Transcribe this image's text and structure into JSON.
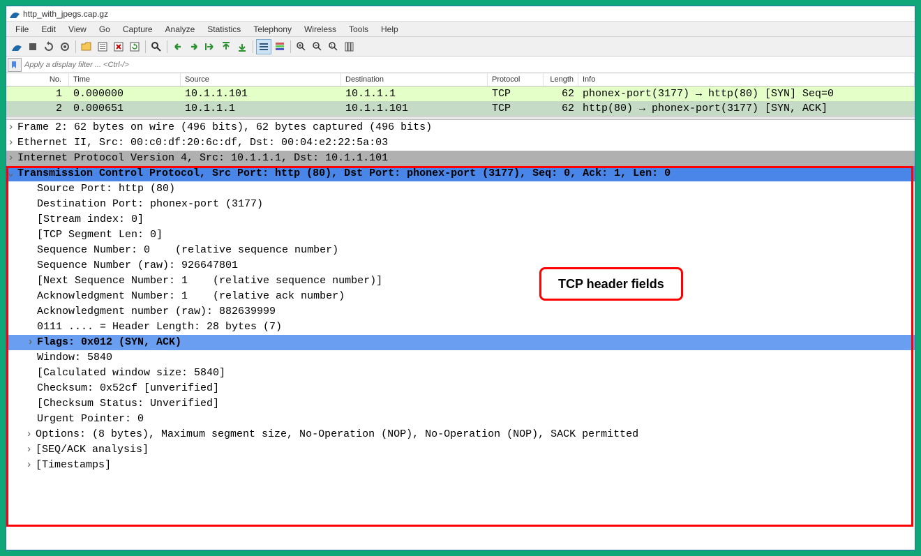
{
  "window": {
    "title": "http_with_jpegs.cap.gz"
  },
  "menu": [
    "File",
    "Edit",
    "View",
    "Go",
    "Capture",
    "Analyze",
    "Statistics",
    "Telephony",
    "Wireless",
    "Tools",
    "Help"
  ],
  "toolbar_icons": [
    "shark-fin",
    "square-stop",
    "restart",
    "gear",
    "folder-open",
    "save",
    "close-x",
    "reload",
    "search",
    "arrow-left",
    "arrow-right",
    "go-to",
    "arrow-up",
    "arrow-down",
    "auto-scroll",
    "colorize",
    "zoom-in",
    "zoom-out",
    "zoom-reset",
    "resize-cols"
  ],
  "filter": {
    "placeholder": "Apply a display filter ... <Ctrl-/>"
  },
  "packet_headers": [
    "No.",
    "Time",
    "Source",
    "Destination",
    "Protocol",
    "Length",
    "Info"
  ],
  "packets": [
    {
      "no": "1",
      "time": "0.000000",
      "src": "10.1.1.101",
      "dst": "10.1.1.1",
      "proto": "TCP",
      "len": "62",
      "info": "phonex-port(3177) → http(80) [SYN] Seq=0"
    },
    {
      "no": "2",
      "time": "0.000651",
      "src": "10.1.1.1",
      "dst": "10.1.1.101",
      "proto": "TCP",
      "len": "62",
      "info": "http(80) → phonex-port(3177) [SYN, ACK]"
    }
  ],
  "details": {
    "frame": "Frame 2: 62 bytes on wire (496 bits), 62 bytes captured (496 bits)",
    "eth": "Ethernet II, Src: 00:c0:df:20:6c:df, Dst: 00:04:e2:22:5a:03",
    "ip": "Internet Protocol Version 4, Src: 10.1.1.1, Dst: 10.1.1.101",
    "tcp": "Transmission Control Protocol, Src Port: http (80), Dst Port: phonex-port (3177), Seq: 0, Ack: 1, Len: 0",
    "tcp_fields": [
      "Source Port: http (80)",
      "Destination Port: phonex-port (3177)",
      "[Stream index: 0]",
      "[TCP Segment Len: 0]",
      "Sequence Number: 0    (relative sequence number)",
      "Sequence Number (raw): 926647801",
      "[Next Sequence Number: 1    (relative sequence number)]",
      "Acknowledgment Number: 1    (relative ack number)",
      "Acknowledgment number (raw): 882639999",
      "0111 .... = Header Length: 28 bytes (7)"
    ],
    "flags": "Flags: 0x012 (SYN, ACK)",
    "after_flags": [
      "Window: 5840",
      "[Calculated window size: 5840]",
      "Checksum: 0x52cf [unverified]",
      "[Checksum Status: Unverified]",
      "Urgent Pointer: 0"
    ],
    "options": "Options: (8 bytes), Maximum segment size, No-Operation (NOP), No-Operation (NOP), SACK permitted",
    "seqack": "[SEQ/ACK analysis]",
    "timestamps": "[Timestamps]"
  },
  "annotation": {
    "label": "TCP header fields"
  }
}
